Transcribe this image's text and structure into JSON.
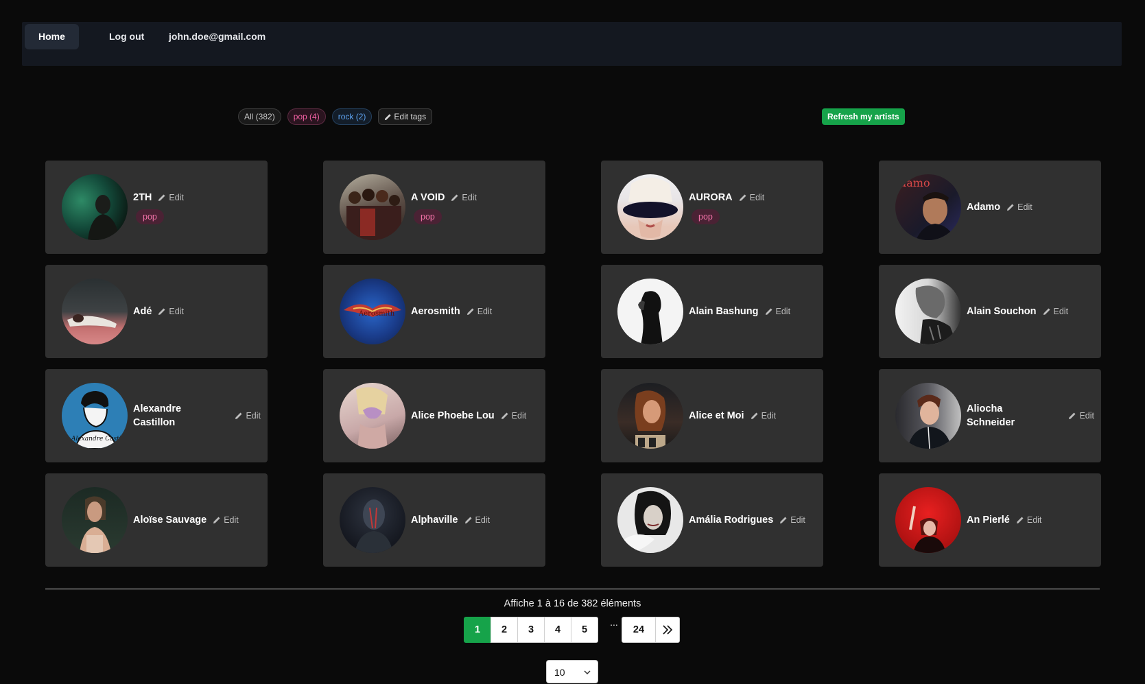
{
  "nav": {
    "items": [
      {
        "label": "Home",
        "active": true
      },
      {
        "label": "Log out",
        "active": false
      },
      {
        "label": "john.doe@gmail.com",
        "active": false
      }
    ]
  },
  "filters": {
    "tags": [
      {
        "label": "All (382)",
        "kind": "all"
      },
      {
        "label": "pop (4)",
        "kind": "pop"
      },
      {
        "label": "rock (2)",
        "kind": "rock"
      }
    ],
    "edit_tags_label": "Edit tags",
    "refresh_label": "Refresh my artists"
  },
  "colors": {
    "accent_green": "#16a34a",
    "pop_pink": "#f060a2",
    "rock_blue": "#5ea3f0",
    "card_bg": "#303030",
    "nav_bg": "#141820"
  },
  "artists": [
    {
      "name": "2TH",
      "tag": "pop",
      "edit": "Edit"
    },
    {
      "name": "A VOID",
      "tag": "pop",
      "edit": "Edit"
    },
    {
      "name": "AURORA",
      "tag": "pop",
      "edit": "Edit"
    },
    {
      "name": "Adamo",
      "tag": null,
      "edit": "Edit"
    },
    {
      "name": "Adé",
      "tag": null,
      "edit": "Edit"
    },
    {
      "name": "Aerosmith",
      "tag": null,
      "edit": "Edit"
    },
    {
      "name": "Alain Bashung",
      "tag": null,
      "edit": "Edit"
    },
    {
      "name": "Alain Souchon",
      "tag": null,
      "edit": "Edit"
    },
    {
      "name": "Alexandre Castillon",
      "tag": null,
      "edit": "Edit"
    },
    {
      "name": "Alice Phoebe Lou",
      "tag": null,
      "edit": "Edit"
    },
    {
      "name": "Alice et Moi",
      "tag": null,
      "edit": "Edit"
    },
    {
      "name": "Aliocha Schneider",
      "tag": null,
      "edit": "Edit"
    },
    {
      "name": "Aloïse Sauvage",
      "tag": null,
      "edit": "Edit"
    },
    {
      "name": "Alphaville",
      "tag": null,
      "edit": "Edit"
    },
    {
      "name": "Amália Rodrigues",
      "tag": null,
      "edit": "Edit"
    },
    {
      "name": "An Pierlé",
      "tag": null,
      "edit": "Edit"
    }
  ],
  "pagination": {
    "summary": "Affiche 1 à 16 de 382 éléments",
    "pages": [
      "1",
      "2",
      "3",
      "4",
      "5"
    ],
    "current": "1",
    "ellipsis": "...",
    "last_page": "24",
    "per_page": "10",
    "next_icon": "double-chevron-right-icon"
  }
}
